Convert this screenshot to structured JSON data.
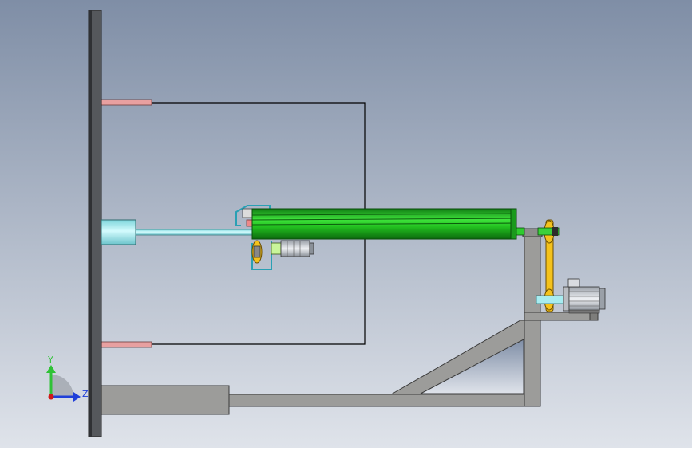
{
  "viewport": {
    "background_top": "#7f8ea6",
    "background_bottom": "#dfe3ea"
  },
  "triad": {
    "y_label": "Y",
    "z_label": "Z",
    "y_color": "#2fc236",
    "z_color": "#1f3fd9",
    "origin_color": "#d01818"
  },
  "colors": {
    "steel": "#9c9c9a",
    "steel_dark": "#5e5e5c",
    "wall": "#55585c",
    "roller_green": "#2ecc2e",
    "shaft_cyan": "#a8ecf0",
    "pin_pink": "#e8a0a0",
    "belt_yellow": "#f4c21c",
    "motor_gray": "#c9ccd1"
  }
}
